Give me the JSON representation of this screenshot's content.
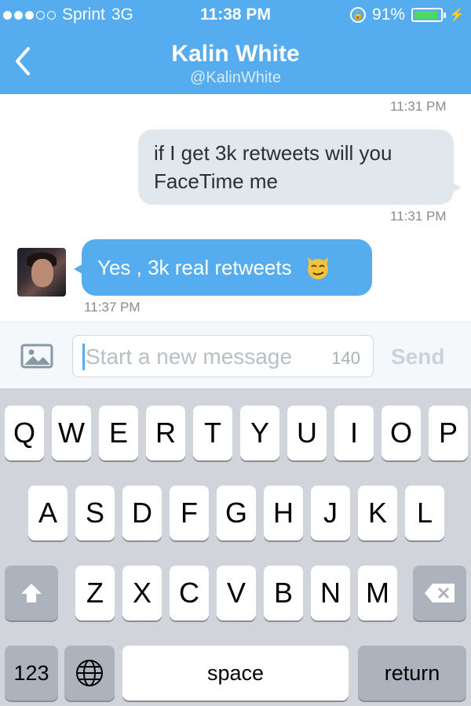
{
  "status_bar": {
    "carrier": "Sprint",
    "network": "3G",
    "time": "11:38 PM",
    "battery": "91%",
    "battery_level": 0.91,
    "signal_bars_filled": 3,
    "signal_bars_total": 5
  },
  "header": {
    "title": "Kalin White",
    "handle": "@KalinWhite"
  },
  "conversation": {
    "top_timestamp": "11:31 PM",
    "messages": [
      {
        "direction": "outgoing",
        "line1": "if I get 3k retweets will you",
        "line2": "FaceTime me",
        "timestamp": "11:31 PM"
      },
      {
        "direction": "incoming",
        "text": "Yes , 3k real retweets",
        "emoji": "smirking-cat",
        "timestamp": "11:37 PM"
      }
    ]
  },
  "compose": {
    "placeholder": "Start a new message",
    "counter": "140",
    "send_label": "Send"
  },
  "keyboard": {
    "row1": [
      "Q",
      "W",
      "E",
      "R",
      "T",
      "Y",
      "U",
      "I",
      "O",
      "P"
    ],
    "row2": [
      "A",
      "S",
      "D",
      "F",
      "G",
      "H",
      "J",
      "K",
      "L"
    ],
    "row3": [
      "Z",
      "X",
      "C",
      "V",
      "B",
      "N",
      "M"
    ],
    "numbers_label": "123",
    "space_label": "space",
    "return_label": "return"
  },
  "colors": {
    "accent": "#55acee",
    "bubble_out": "#e1e8ed",
    "keyboard_bg": "#d1d5db"
  }
}
